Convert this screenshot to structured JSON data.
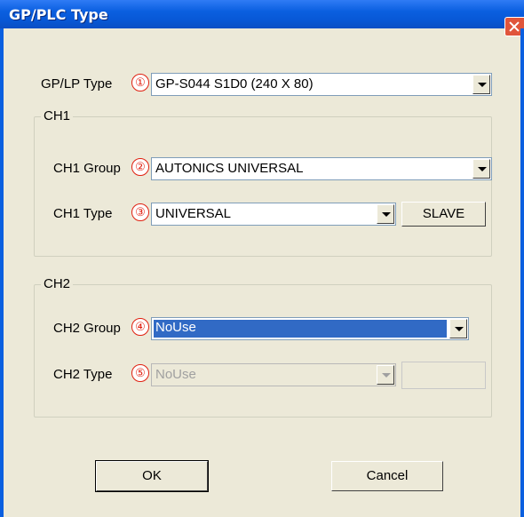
{
  "window": {
    "title": "GP/PLC Type"
  },
  "gp": {
    "label": "GP/LP Type",
    "marker": "①",
    "value": "GP-S044  S1D0  (240 X 80)"
  },
  "ch1": {
    "title": "CH1",
    "group_label": "CH1 Group",
    "group_marker": "②",
    "group_value": "AUTONICS UNIVERSAL",
    "type_label": "CH1 Type",
    "type_marker": "③",
    "type_value": "UNIVERSAL",
    "mode_button": "SLAVE"
  },
  "ch2": {
    "title": "CH2",
    "group_label": "CH2 Group",
    "group_marker": "④",
    "group_value": "NoUse",
    "type_label": "CH2 Type",
    "type_marker": "⑤",
    "type_value": "NoUse",
    "mode_button": ""
  },
  "buttons": {
    "ok": "OK",
    "cancel": "Cancel"
  },
  "colors": {
    "title_bar": "#0a5fe0",
    "marker": "#e02010",
    "selection": "#316ac5",
    "dialog_bg": "#ece9d8"
  }
}
